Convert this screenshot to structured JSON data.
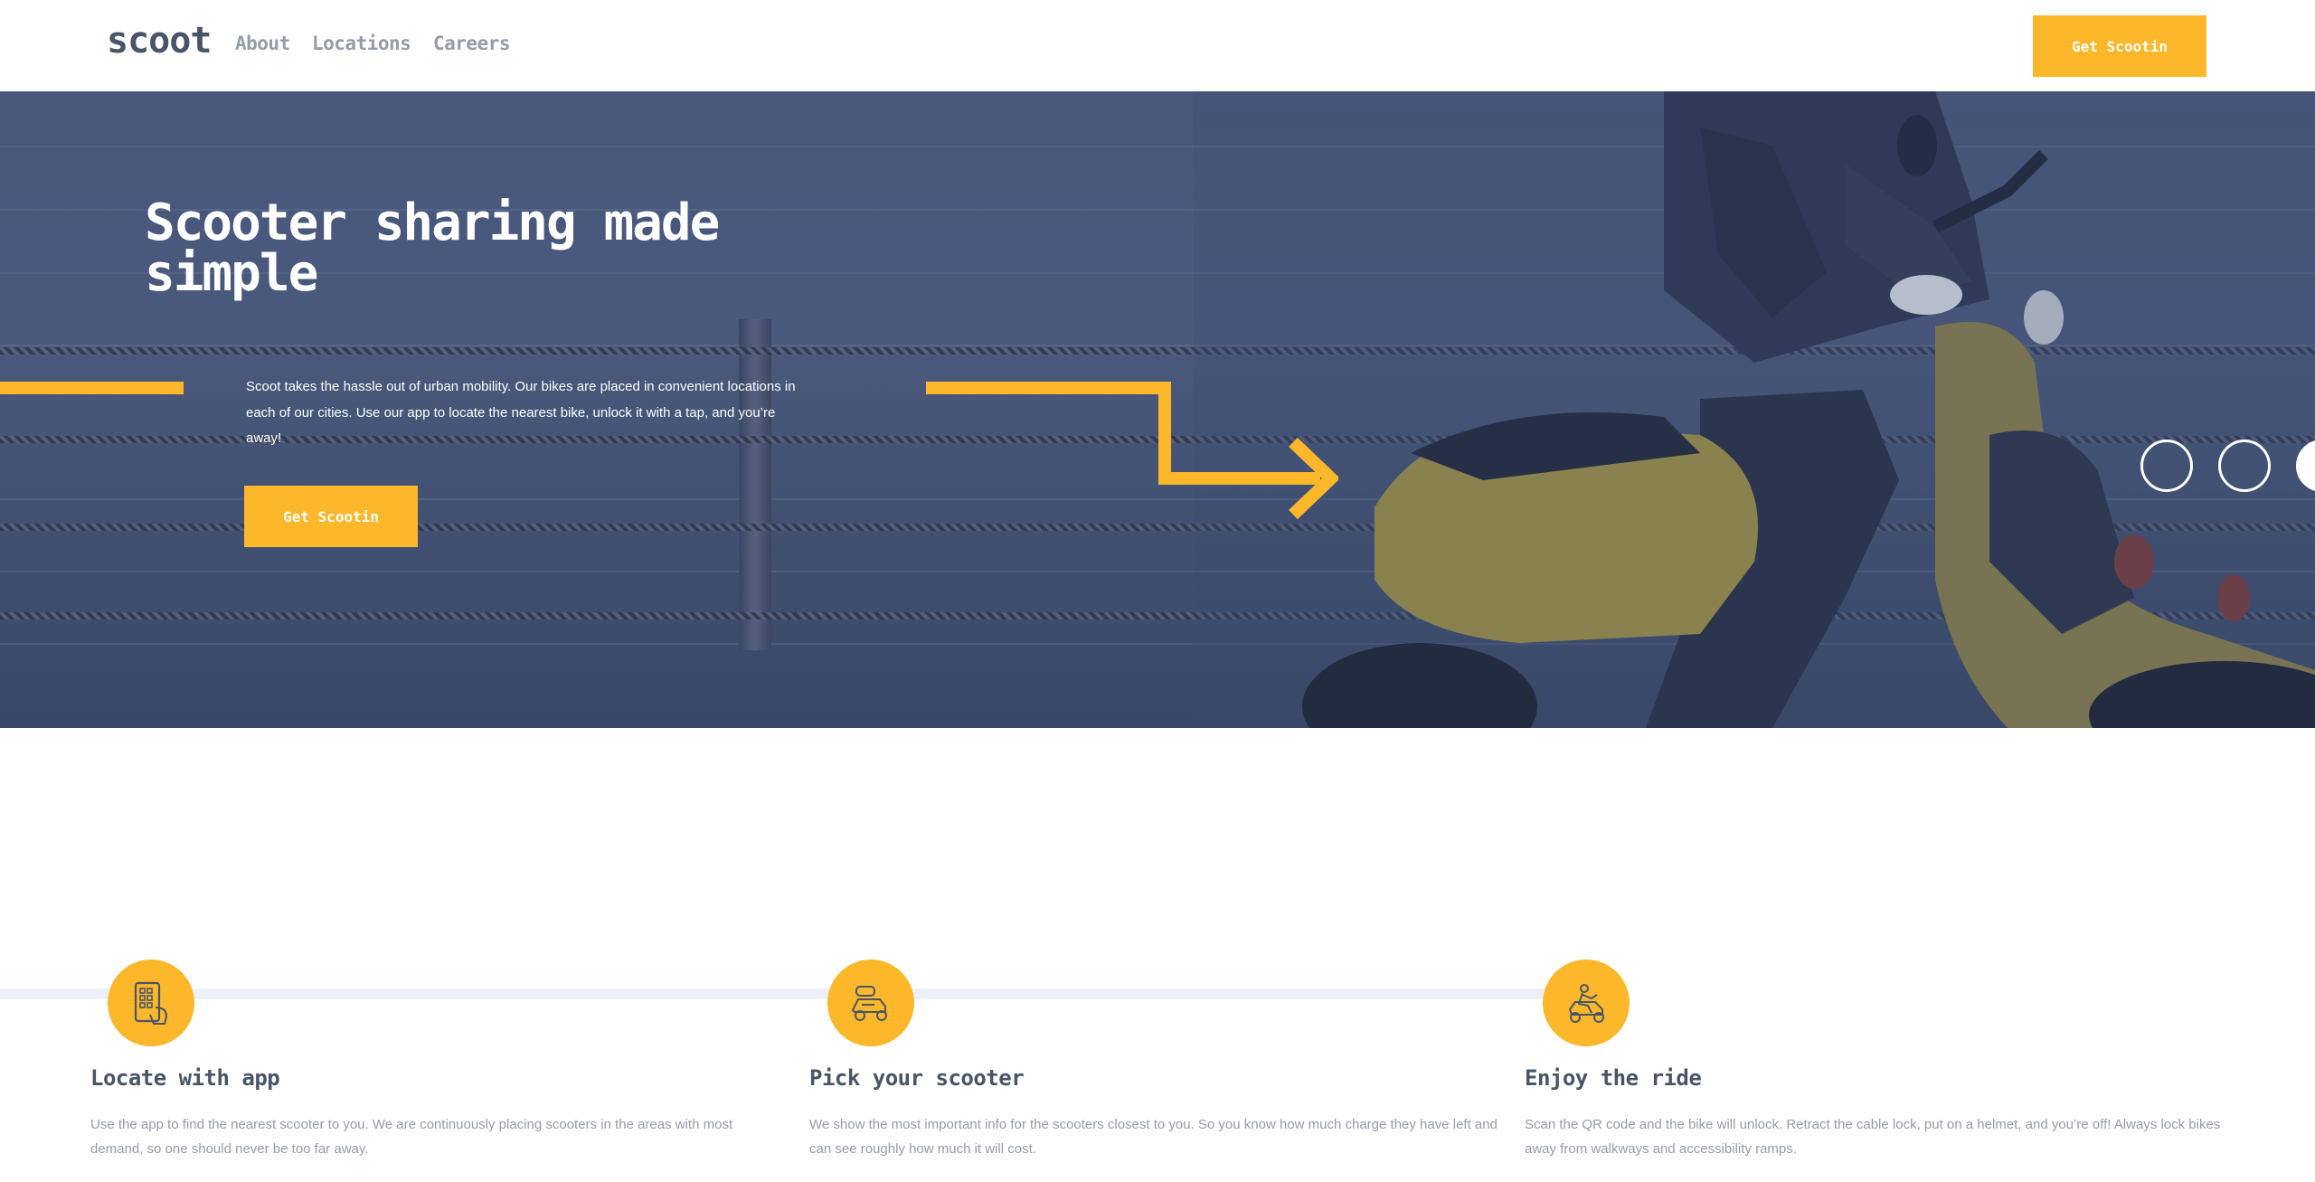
{
  "brand": {
    "logo": "scoot"
  },
  "nav": {
    "links": [
      "About",
      "Locations",
      "Careers"
    ],
    "cta_label": "Get Scootin"
  },
  "hero": {
    "title": "Scooter sharing made simple",
    "description": "Scoot takes the hassle out of urban mobility. Our bikes are placed in convenient locations in each of our cities. Use our app to locate the nearest bike, unlock it with a tap, and you’re away!",
    "cta_label": "Get Scootin"
  },
  "features": [
    {
      "icon": "phone-app-icon",
      "title": "Locate with app",
      "text": "Use the app to find the nearest scooter to you. We are continuously placing scooters in the areas with most demand, so one should never be too far away."
    },
    {
      "icon": "scooter-icon",
      "title": "Pick your scooter",
      "text": "We show the most important info for the scooters closest to you. So you know how much charge they have left and can see roughly how much it will cost."
    },
    {
      "icon": "rider-icon",
      "title": "Enjoy the ride",
      "text": "Scan the QR code and the bike will unlock. Retract the cable lock, put on a helmet, and you’re off! Always lock bikes away from walkways and accessibility ramps."
    }
  ],
  "colors": {
    "accent": "#fcb72b",
    "dark_navy": "#495567",
    "dim_grey": "#939caa",
    "hero_overlay": "#4a5a7e",
    "track": "#edf1f7"
  }
}
